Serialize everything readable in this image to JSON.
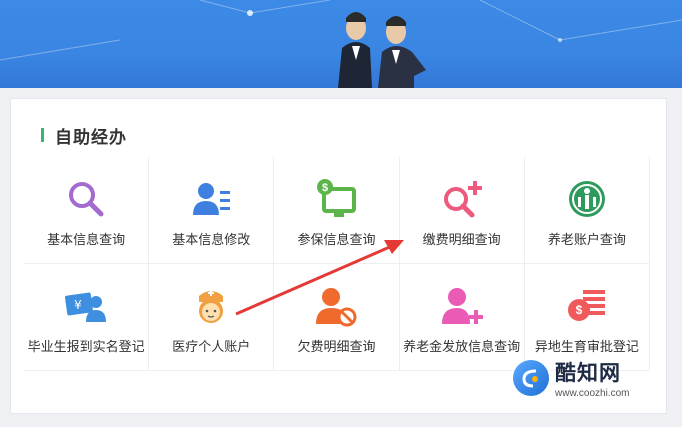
{
  "section": {
    "title": "自助经办"
  },
  "grid": {
    "items": [
      {
        "label": "基本信息查询",
        "icon": "search-icon",
        "color": "#a36bcf"
      },
      {
        "label": "基本信息修改",
        "icon": "user-edit-icon",
        "color": "#3f7fe0"
      },
      {
        "label": "参保信息查询",
        "icon": "monitor-dollar-icon",
        "color": "#5bb54a"
      },
      {
        "label": "缴费明细查询",
        "icon": "search-plus-icon",
        "color": "#ee5a7e"
      },
      {
        "label": "养老账户查询",
        "icon": "pension-logo-icon",
        "color": "#2e9a5c"
      },
      {
        "label": "毕业生报到实名登记",
        "icon": "graduate-card-icon",
        "color": "#3f8fe0"
      },
      {
        "label": "医疗个人账户",
        "icon": "nurse-icon",
        "color": "#f0a040"
      },
      {
        "label": "欠费明细查询",
        "icon": "user-ban-icon",
        "color": "#f06a2e"
      },
      {
        "label": "养老金发放信息查询",
        "icon": "user-add-icon",
        "color": "#e95bb5"
      },
      {
        "label": "异地生育审批登记",
        "icon": "money-list-icon",
        "color": "#f05a5a"
      }
    ]
  },
  "watermark": {
    "name": "酷知网",
    "url": "www.coozhi.com"
  },
  "colors": {
    "banner": "#3c8ae6",
    "accent_bar": "#3cb371",
    "arrow": "#e53935"
  }
}
